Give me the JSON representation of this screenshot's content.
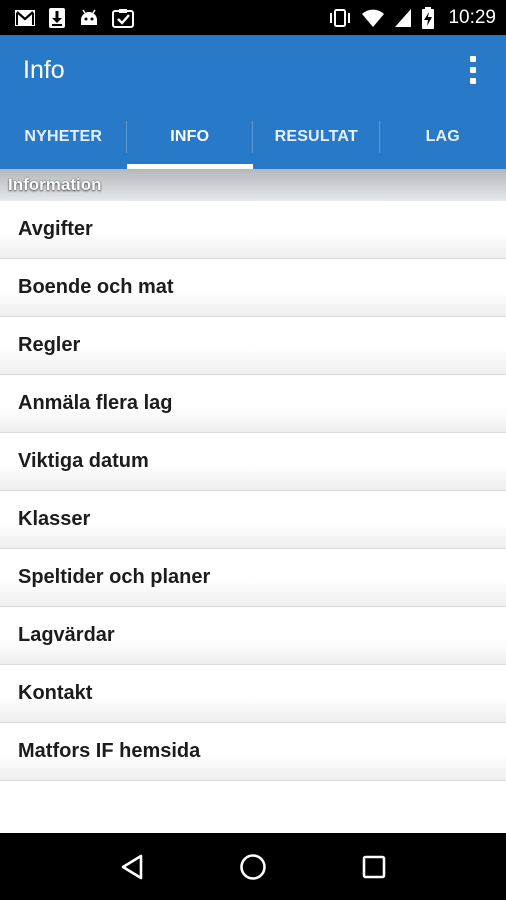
{
  "status_bar": {
    "time": "10:29",
    "icons_left": [
      "gmail-icon",
      "download-icon",
      "android-icon",
      "clipboard-check-icon"
    ],
    "icons_right": [
      "vibrate-icon",
      "wifi-icon",
      "signal-icon",
      "battery-charging-icon"
    ]
  },
  "app_bar": {
    "title": "Info",
    "menu_icon": "overflow-menu-icon",
    "background": "#2979c9"
  },
  "tabs": [
    {
      "label": "NYHETER",
      "active": false
    },
    {
      "label": "INFO",
      "active": true
    },
    {
      "label": "RESULTAT",
      "active": false
    },
    {
      "label": "LAG",
      "active": false
    }
  ],
  "section": {
    "title": "Information"
  },
  "items": [
    {
      "label": "Avgifter"
    },
    {
      "label": "Boende och mat"
    },
    {
      "label": "Regler"
    },
    {
      "label": "Anmäla flera lag"
    },
    {
      "label": "Viktiga datum"
    },
    {
      "label": "Klasser"
    },
    {
      "label": "Speltider och planer"
    },
    {
      "label": "Lagvärdar"
    },
    {
      "label": "Kontakt"
    },
    {
      "label": "Matfors IF hemsida"
    }
  ],
  "nav_bar": {
    "buttons": [
      "back-icon",
      "home-icon",
      "recents-icon"
    ]
  }
}
